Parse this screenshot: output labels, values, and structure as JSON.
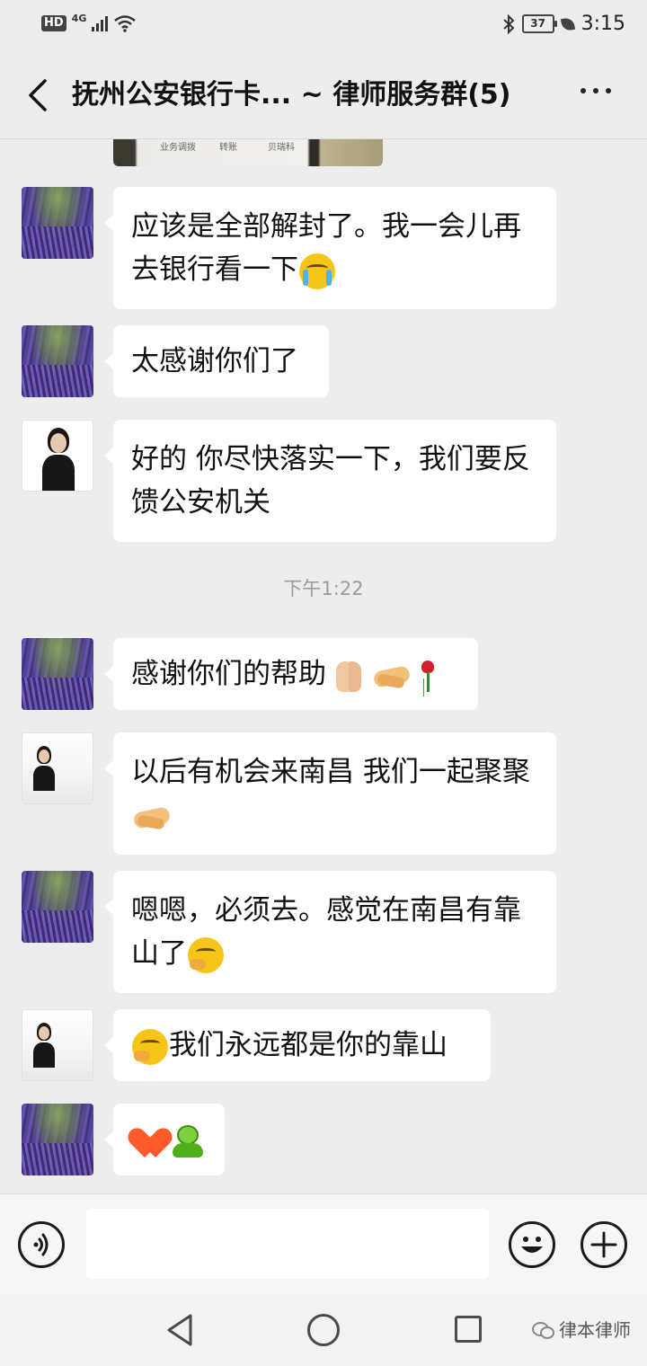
{
  "status_bar": {
    "hd": "HD",
    "network": "4G",
    "battery": "37",
    "time": "3:15"
  },
  "header": {
    "title": "抚州公安银行卡... ~ 律师服务群(5)"
  },
  "image_message": {
    "texts": [
      "业务调拨",
      "转账",
      "贝瑞科"
    ]
  },
  "messages": [
    {
      "text": "应该是全部解封了。我一会儿再去银行看一下",
      "emoji": "loudly-crying-face"
    },
    {
      "text": "太感谢你们了"
    },
    {
      "text": "好的 你尽快落实一下，我们要反馈公安机关"
    },
    {
      "text": "感谢你们的帮助",
      "emoji": "folded-hands, handshake, rose"
    },
    {
      "text": "以后有机会来南昌 我们一起聚聚",
      "emoji": "handshake"
    },
    {
      "text": "嗯嗯，必须去。感觉在南昌有靠山了",
      "emoji": "hand-over-mouth-face"
    },
    {
      "text": "我们永远都是你的靠山",
      "emoji": "hand-over-mouth-face"
    },
    {
      "text": "",
      "emoji": "heart, frog"
    }
  ],
  "timestamp": "下午1:22",
  "input": {
    "value": ""
  },
  "watermark": "律本律师",
  "icons": {
    "back": "chevron-left-icon",
    "more": "more-dots-icon",
    "voice": "voice-icon",
    "emoji": "smiley-icon",
    "plus": "plus-icon"
  }
}
